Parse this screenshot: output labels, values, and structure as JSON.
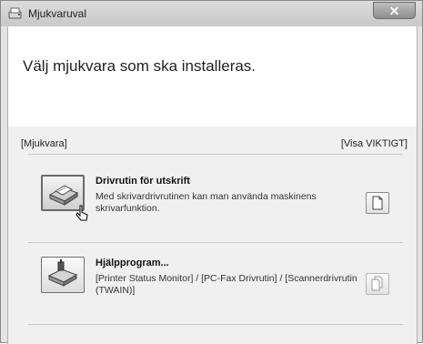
{
  "window": {
    "title": "Mjukvaruval",
    "close_glyph": "✕"
  },
  "header": {
    "heading": "Välj mjukvara som ska installeras."
  },
  "section": {
    "left_label": "[Mjukvara]",
    "right_label": "[Visa VIKTIGT]"
  },
  "items": [
    {
      "title": "Drivrutin för utskrift",
      "description": "Med skrivardrivrutinen kan man använda maskinens skrivarfunktion.",
      "icon": "printer-driver-icon",
      "action_icon": "document-icon"
    },
    {
      "title": "Hjälpprogram...",
      "description": "[Printer Status Monitor] / [PC-Fax Drivrutin] / [Scannerdrivrutin (TWAIN)]",
      "icon": "utility-icon",
      "action_icon": "documents-icon"
    }
  ]
}
